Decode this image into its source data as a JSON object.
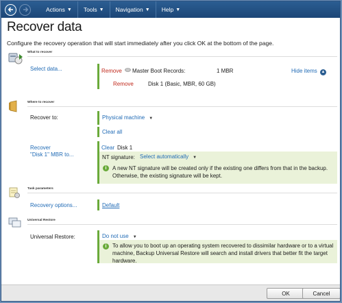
{
  "menu": {
    "items": [
      {
        "label": "Actions",
        "name": "menu-actions"
      },
      {
        "label": "Tools",
        "name": "menu-tools"
      },
      {
        "label": "Navigation",
        "name": "menu-navigation"
      },
      {
        "label": "Help",
        "name": "menu-help"
      }
    ]
  },
  "page": {
    "title": "Recover data",
    "description": "Configure the recovery operation that will start immediately after you click OK at the bottom of the page."
  },
  "what_to_recover": {
    "heading": "What to recover",
    "select_data_label": "Select data...",
    "items": [
      {
        "remove": "Remove",
        "name": "Master Boot Records:",
        "size": "1 MBR"
      },
      {
        "remove": "Remove",
        "name": "Disk 1 (Basic, MBR, 60 GB)"
      }
    ],
    "hide_items": "Hide items"
  },
  "where_to_recover": {
    "heading": "Where to recover",
    "recover_to_label": "Recover to:",
    "recover_to_value": "Physical machine",
    "clear_all": "Clear all",
    "recover_disk_label_1": "Recover",
    "recover_disk_label_2": "\"Disk 1\" MBR to...",
    "clear": "Clear",
    "target": "Disk 1",
    "nt_signature_label": "NT signature:",
    "nt_signature_value": "Select automatically",
    "nt_info": "A new NT signature will be created only if the existing one differs from that in the backup. Otherwise, the existing signature will be kept."
  },
  "task_parameters": {
    "heading": "Task parameters",
    "recovery_options": "Recovery options...",
    "default": "Default"
  },
  "universal_restore": {
    "heading": "Universal Restore",
    "label": "Universal Restore:",
    "value": "Do not use",
    "info": "To allow you to boot up an operating system recovered to dissimilar hardware or to a virtual machine, Backup Universal Restore will search and install drivers that better fit the target hardware."
  },
  "buttons": {
    "ok": "OK",
    "cancel": "Cancel"
  }
}
